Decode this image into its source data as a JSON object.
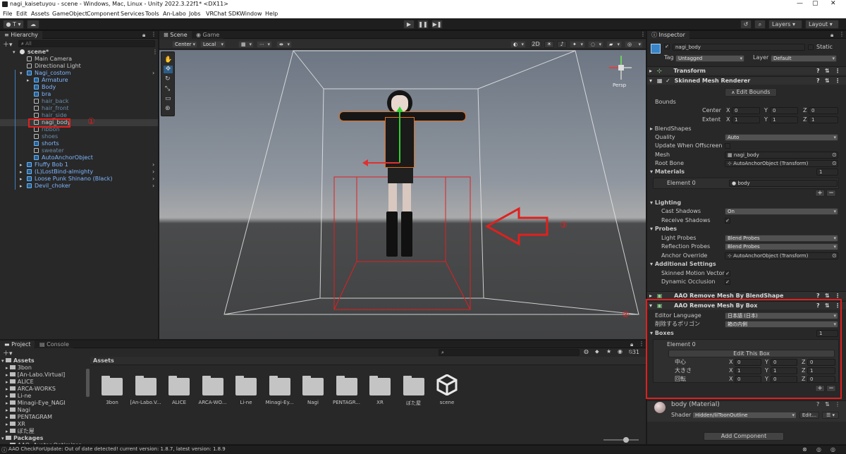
{
  "window": {
    "title": "nagi_kaisetuyou - scene - Windows, Mac, Linux - Unity 2022.3.22f1* <DX11>"
  },
  "menu": [
    "File",
    "Edit",
    "Assets",
    "GameObject",
    "Component",
    "Services",
    "Tools",
    "An-Labo",
    "Jobs",
    "VRChat SDK",
    "Window",
    "Help"
  ],
  "toolbar": {
    "account": "T",
    "layers": "Layers",
    "layout": "Layout"
  },
  "hierarchy": {
    "tab": "Hierarchy",
    "search_placeholder": "All",
    "items": [
      {
        "label": "scene*",
        "indent": 0
      },
      {
        "label": "Main Camera",
        "indent": 1
      },
      {
        "label": "Directional Light",
        "indent": 1
      },
      {
        "label": "Nagi_costom",
        "indent": 1
      },
      {
        "label": "Armature",
        "indent": 2
      },
      {
        "label": "Body",
        "indent": 2
      },
      {
        "label": "bra",
        "indent": 2
      },
      {
        "label": "hair_back",
        "indent": 2
      },
      {
        "label": "hair_front",
        "indent": 2
      },
      {
        "label": "hair_side",
        "indent": 2
      },
      {
        "label": "nagi_body",
        "indent": 2
      },
      {
        "label": "ribbon",
        "indent": 2
      },
      {
        "label": "shoes",
        "indent": 2
      },
      {
        "label": "shorts",
        "indent": 2
      },
      {
        "label": "sweater",
        "indent": 2
      },
      {
        "label": "AutoAnchorObject",
        "indent": 2
      },
      {
        "label": "Fluffy Bob 1",
        "indent": 1
      },
      {
        "label": "(L)LostBind-almighty",
        "indent": 1
      },
      {
        "label": "Loose Punk Shinano (Black)",
        "indent": 1
      },
      {
        "label": "Devil_choker",
        "indent": 1
      }
    ]
  },
  "scene": {
    "tab_scene": "Scene",
    "tab_game": "Game",
    "pivot": "Center",
    "space": "Local",
    "mode_2d": "2D",
    "persp": "Persp"
  },
  "inspector": {
    "tab": "Inspector",
    "object_name": "nagi_body",
    "static": "Static",
    "tag_label": "Tag",
    "tag_value": "Untagged",
    "layer_label": "Layer",
    "layer_value": "Default",
    "transform": "Transform",
    "smr": "Skinned Mesh Renderer",
    "edit_bounds": "Edit Bounds",
    "bounds": "Bounds",
    "center": "Center",
    "extent": "Extent",
    "cx": "0",
    "cy": "0",
    "cz": "0",
    "ex": "1",
    "ey": "1",
    "ez": "1",
    "blendshapes": "BlendShapes",
    "quality": "Quality",
    "quality_value": "Auto",
    "update_offscreen": "Update When Offscreen",
    "mesh": "Mesh",
    "mesh_value": "nagi_body",
    "root_bone": "Root Bone",
    "root_bone_value": "AutoAnchorObject (Transform)",
    "materials": "Materials",
    "materials_count": "1",
    "element0": "Element 0",
    "element0_value": "body",
    "lighting": "Lighting",
    "cast_shadows": "Cast Shadows",
    "cast_shadows_value": "On",
    "receive_shadows": "Receive Shadows",
    "probes": "Probes",
    "light_probes": "Light Probes",
    "light_probes_value": "Blend Probes",
    "reflection_probes": "Reflection Probes",
    "reflection_probes_value": "Blend Probes",
    "anchor_override": "Anchor Override",
    "anchor_override_value": "AutoAnchorObject (Transform)",
    "additional": "Additional Settings",
    "skinned_motion": "Skinned Motion Vectors",
    "dynamic_occlusion": "Dynamic Occlusion",
    "aao_blendshape": "AAO Remove Mesh By BlendShape",
    "aao_box": "AAO Remove Mesh By Box",
    "editor_language": "Editor Language",
    "editor_language_value": "日本語 (日本)",
    "remove_polygon": "削除するポリゴン",
    "remove_polygon_value": "箱の内側",
    "boxes": "Boxes",
    "boxes_count": "1",
    "box_element": "Element 0",
    "edit_this_box": "Edit This Box",
    "box_center": "中心",
    "box_size": "大きさ",
    "box_rotation": "回転",
    "bcx": "0",
    "bcy": "0",
    "bcz": "0",
    "bsx": "1",
    "bsy": "1",
    "bsz": "1",
    "brx": "0",
    "bry": "0",
    "brz": "0",
    "material_header": "body (Material)",
    "shader_label": "Shader",
    "shader_value": "Hidden/lilToonOutline",
    "edit_btn": "Edit...",
    "add_component": "Add Component"
  },
  "project": {
    "tab_project": "Project",
    "tab_console": "Console",
    "assets_header": "Assets",
    "tree": [
      "Assets",
      "3bon",
      "[An-Labo.Virtual]",
      "ALICE",
      "ARCA-WORKS",
      "Li-ne",
      "Minagi-Eye_NAGI",
      "Nagi",
      "PENTAGRAM",
      "XR",
      "ぼた屋",
      "Packages",
      "AAO: Avatar Optimizer"
    ],
    "files": [
      "3bon",
      "[An-Labo.V...",
      "ALICE",
      "ARCA-WO...",
      "Li-ne",
      "Minagi-Ey...",
      "Nagi",
      "PENTAGR...",
      "XR",
      "ぼた屋",
      "scene"
    ],
    "count": "31"
  },
  "status": {
    "text": "AAO CheckForUpdate: Out of date detected! current version: 1.8.7, latest version: 1.8.9"
  },
  "annotations": {
    "one": "①",
    "two": "②",
    "three": "③"
  },
  "colors": {
    "accent": "#e0201e",
    "selection": "#2c5d87",
    "prefab": "#7eb6ff"
  }
}
